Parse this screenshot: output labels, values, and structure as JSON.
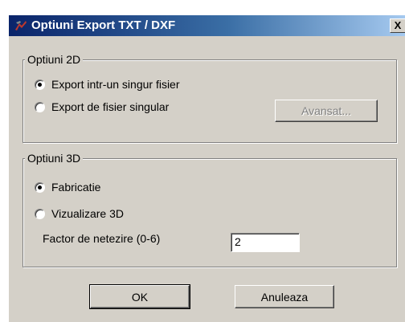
{
  "window": {
    "title": "Optiuni Export TXT / DXF",
    "close_label": "X"
  },
  "group_2d": {
    "label": "Optiuni 2D",
    "options": [
      {
        "label": "Export intr-un singur fisier",
        "checked": true
      },
      {
        "label": "Export de fisier singular",
        "checked": false
      }
    ],
    "advanced_button": "Avansat...",
    "advanced_enabled": false
  },
  "group_3d": {
    "label": "Optiuni 3D",
    "options": [
      {
        "label": "Fabricatie",
        "checked": true
      },
      {
        "label": "Vizualizare 3D",
        "checked": false
      }
    ],
    "smoothing_label": "Factor de netezire (0-6)",
    "smoothing_value": "2"
  },
  "buttons": {
    "ok": "OK",
    "cancel": "Anuleaza"
  }
}
